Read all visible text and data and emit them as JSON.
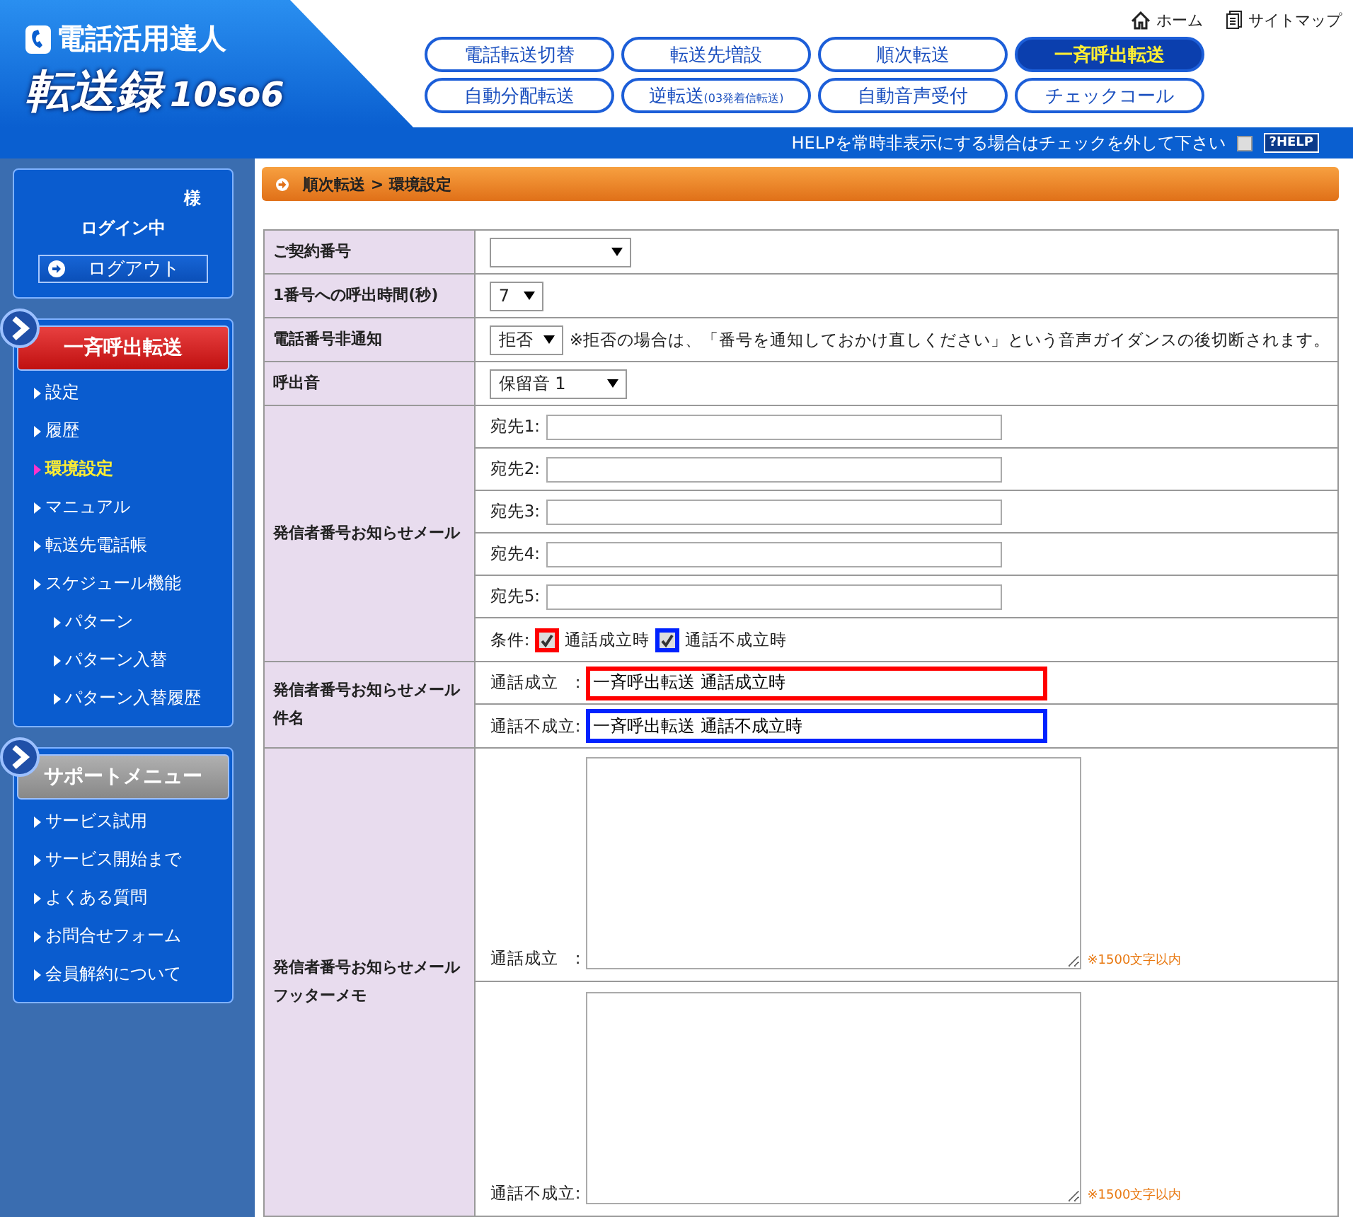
{
  "header": {
    "logo": {
      "tagline": "電話活用達人",
      "title": "転送録",
      "version": "10so6"
    },
    "links": [
      {
        "kind": "home",
        "label": "ホーム"
      },
      {
        "kind": "sitemap",
        "label": "サイトマップ"
      }
    ],
    "nav": [
      {
        "label": "電話転送切替",
        "selected": false
      },
      {
        "label": "転送先増設",
        "selected": false
      },
      {
        "label": "順次転送",
        "selected": false
      },
      {
        "label": "一斉呼出転送",
        "selected": true
      },
      {
        "label": "自動分配転送",
        "selected": false
      },
      {
        "label": "逆転送",
        "note": "(03発着信転送)",
        "selected": false
      },
      {
        "label": "自動音声受付",
        "selected": false
      },
      {
        "label": "チェックコール",
        "selected": false
      }
    ],
    "help": {
      "text": "HELPを常時非表示にする場合はチェックを外して下さい",
      "checked": false,
      "button": "?HELP"
    }
  },
  "sidebar": {
    "user": {
      "suffix": "様",
      "status": "ログイン中",
      "logout": "ログアウト"
    },
    "menus": [
      {
        "title": "一斉呼出転送",
        "kind": "primary",
        "items": [
          {
            "label": "設定",
            "selected": false
          },
          {
            "label": "履歴",
            "selected": false
          },
          {
            "label": "環境設定",
            "selected": true
          },
          {
            "label": "マニュアル",
            "selected": false
          },
          {
            "label": "転送先電話帳",
            "selected": false
          },
          {
            "label": "スケジュール機能",
            "selected": false,
            "children": [
              {
                "label": "パターン",
                "selected": false
              },
              {
                "label": "パターン入替",
                "selected": false
              },
              {
                "label": "パターン入替履歴",
                "selected": false
              }
            ]
          }
        ]
      },
      {
        "title": "サポートメニュー",
        "kind": "support",
        "items": [
          {
            "label": "サービス試用",
            "selected": false
          },
          {
            "label": "サービス開始まで",
            "selected": false
          },
          {
            "label": "よくある質問",
            "selected": false
          },
          {
            "label": "お問合せフォーム",
            "selected": false
          },
          {
            "label": "会員解約について",
            "selected": false
          }
        ]
      }
    ]
  },
  "breadcrumb": "順次転送 > 環境設定",
  "form": [
    {
      "kind": "select",
      "label": "ご契約番号"
    },
    {
      "kind": "select",
      "label": "1番号への呼出時間(秒)",
      "value": "7"
    },
    {
      "kind": "select",
      "label": "電話番号非通知",
      "value": "拒否",
      "note": "※拒否の場合は、「番号を通知しておかけ直しください」という音声ガイダンスの後切断されます。"
    },
    {
      "kind": "select",
      "label": "呼出音",
      "value": "保留音 1"
    },
    {
      "kind": "mail",
      "label": "発信者番号お知らせメール",
      "recipients": [
        "宛先1:",
        "宛先2:",
        "宛先3:",
        "宛先4:",
        "宛先5:"
      ],
      "condition": {
        "label": "条件:",
        "options": [
          {
            "label": "通話成立時",
            "checked": true,
            "color": "#ff0000"
          },
          {
            "label": "通話不成立時",
            "checked": true,
            "color": "#0022ff"
          }
        ]
      }
    },
    {
      "kind": "subject",
      "label": [
        "発信者番号お知らせメール",
        "件名"
      ],
      "fields": [
        {
          "label": "通話成立　:",
          "value": "一斉呼出転送 通話成立時",
          "color": "#ff0000"
        },
        {
          "label": "通話不成立:",
          "value": "一斉呼出転送 通話不成立時",
          "color": "#0022ff"
        }
      ]
    },
    {
      "kind": "footer",
      "label": [
        "発信者番号お知らせメール",
        "フッターメモ"
      ],
      "fields": [
        {
          "label": "通話成立　:",
          "note": "※1500文字以内"
        },
        {
          "label": "通話不成立:",
          "note": "※1500文字以内"
        }
      ]
    }
  ]
}
